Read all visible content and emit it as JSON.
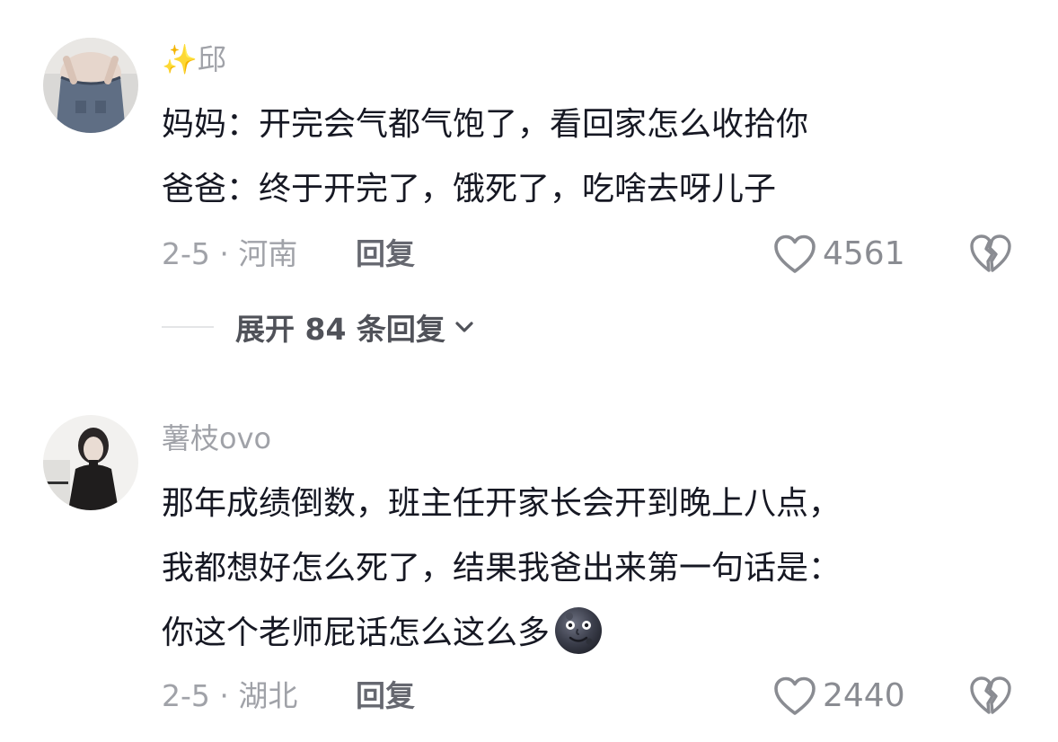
{
  "comments": [
    {
      "username": "✨邱",
      "lines": [
        "妈妈：开完会气都气饱了，看回家怎么收拾你",
        "爸爸：终于开完了，饿死了，吃啥去呀儿子"
      ],
      "date_location": "2-5 · 河南",
      "reply_label": "回复",
      "like_count": "4561",
      "expand_label": "展开 84 条回复"
    },
    {
      "username": "薯枝ovo",
      "lines": [
        "那年成绩倒数，班主任开家长会开到晚上八点，",
        "我都想好怎么死了，结果我爸出来第一句话是：",
        "你这个老师屁话怎么这么多"
      ],
      "date_location": "2-5 · 湖北",
      "reply_label": "回复",
      "like_count": "2440"
    }
  ],
  "colors": {
    "text_primary": "#161823",
    "text_secondary": "#a0a2a8",
    "icon_gray": "#8a8c92"
  },
  "icons": {
    "like": "heart-outline-icon",
    "dislike": "broken-heart-icon",
    "expand": "chevron-down-icon",
    "emoji": "new-moon-face-emoji"
  }
}
